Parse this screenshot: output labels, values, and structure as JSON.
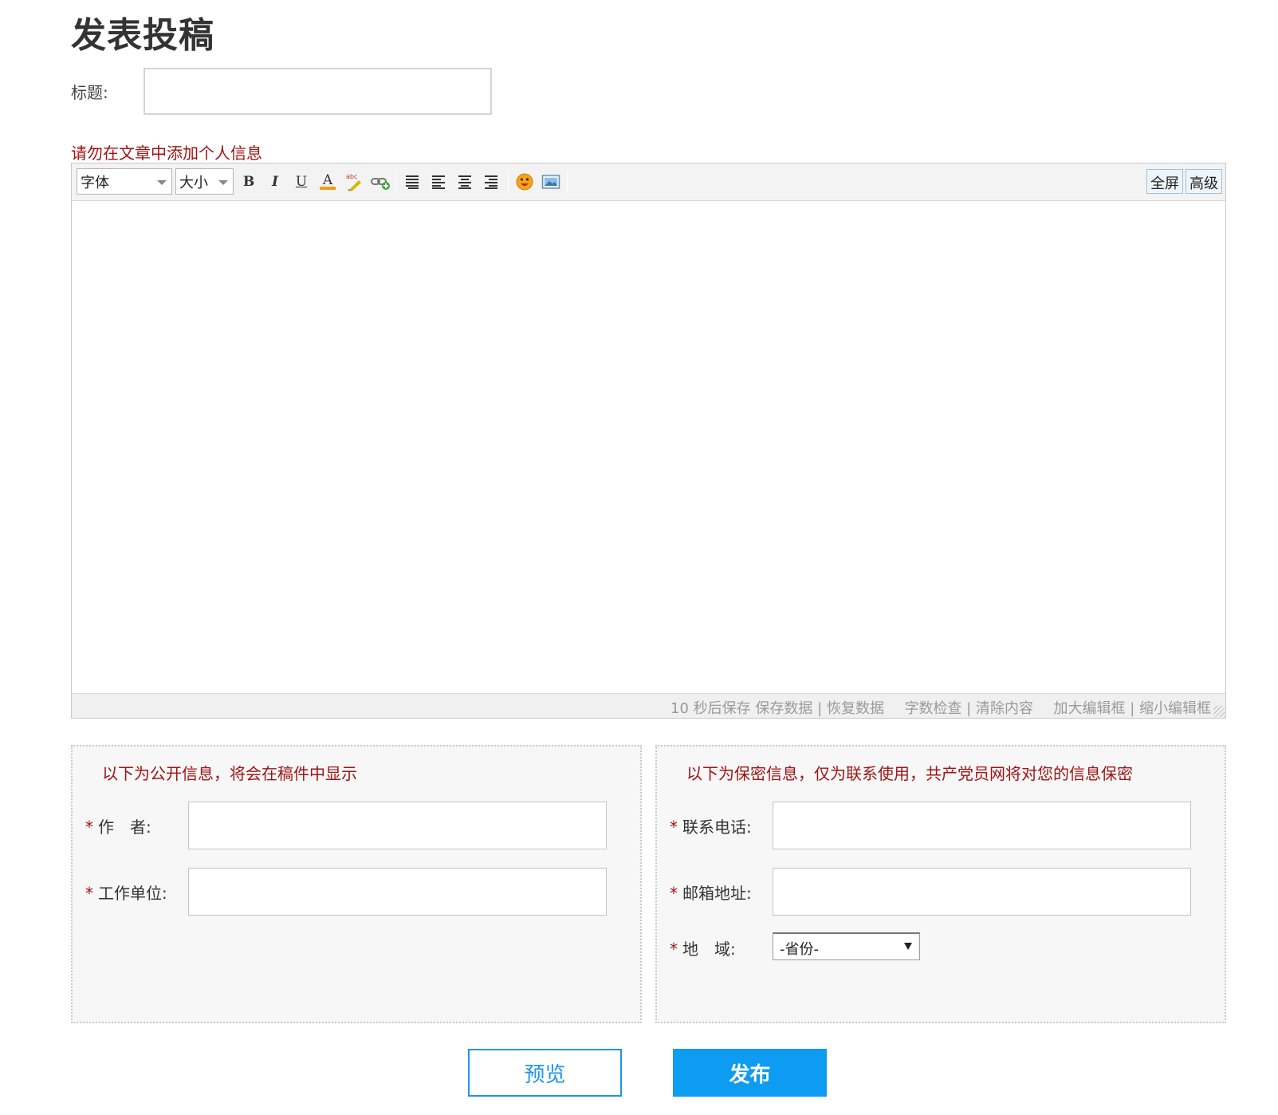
{
  "page": {
    "title": "发表投稿"
  },
  "title_field": {
    "label": "标题:",
    "value": ""
  },
  "warning": "请勿在文章中添加个人信息",
  "editor": {
    "toolbar": {
      "font_select": "字体",
      "size_select": "大小",
      "format_buttons": [
        "B",
        "I",
        "U",
        "A"
      ],
      "icons": [
        "bold-icon",
        "italic-icon",
        "underline-icon",
        "font-color-icon",
        "highlight-icon",
        "link-icon",
        "align-justify-icon",
        "align-left-icon",
        "align-center-icon",
        "align-right-icon",
        "emoticon-icon",
        "image-icon"
      ],
      "fullscreen_label": "全屏",
      "advanced_label": "高级"
    },
    "content": "",
    "footer": {
      "autosave": "10 秒后保存",
      "save_data": "保存数据",
      "restore_data": "恢复数据",
      "word_check": "字数检查",
      "clear_content": "清除内容",
      "enlarge": "加大编辑框",
      "shrink": "缩小编辑框",
      "separator": "|"
    }
  },
  "public_panel": {
    "note": "以下为公开信息，将会在稿件中显示",
    "fields": [
      {
        "required": "*",
        "label": "作　者:",
        "value": ""
      },
      {
        "required": "*",
        "label": "工作单位:",
        "value": ""
      }
    ]
  },
  "private_panel": {
    "note": "以下为保密信息，仅为联系使用，共产党员网将对您的信息保密",
    "fields": [
      {
        "required": "*",
        "label": "联系电话:",
        "value": ""
      },
      {
        "required": "*",
        "label": "邮箱地址:",
        "value": ""
      }
    ],
    "region": {
      "required": "*",
      "label": "地　域:",
      "selected": "-省份-"
    }
  },
  "actions": {
    "preview": "预览",
    "publish": "发布"
  },
  "colors": {
    "accent": "#0e9bf2",
    "warning": "#a01414",
    "panel_bg": "#f7f7f7"
  }
}
